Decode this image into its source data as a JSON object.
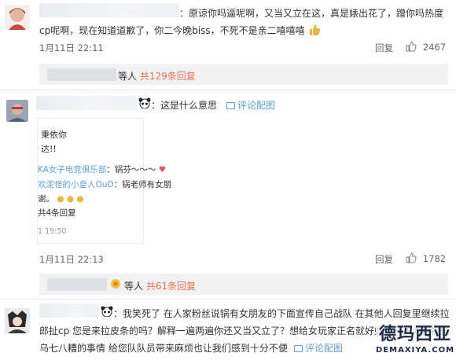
{
  "c1": {
    "line1": "：原谅你吗逼呢啊，又当又立在这，真是婊出花了，蹭你吗热度",
    "line2": "cp呢啊，现在知道道歉了，你二今晚biss，不死不是亲二嘻嘻嘻",
    "time": "1月11日 22:11",
    "reply": "回复",
    "like_count": "2467",
    "sub_people": "等人",
    "sub_count": "共129条回复"
  },
  "c2": {
    "text": "：这是什么意思",
    "img_comment": "评论配图",
    "thumb": {
      "l1": "秉依你",
      "l2": "达!!",
      "l3a": "KA女子电竞俱乐部",
      "l3b": "：锅芬～～～",
      "l4a": "欢泥怪的小皇人OuO",
      "l4b": "：锅老师有女朋",
      "l5": "谢。",
      "l6": "共4条回复",
      "l7": "1 19:50"
    },
    "time": "1月11日 22:13",
    "reply": "回复",
    "like_count": "1782",
    "sub_people": "等人",
    "sub_count": "共61条回复"
  },
  "c3": {
    "line1": "：我笑死了 在人家粉丝说锅有女朋友的下面宣传自己战队 在其他人回复里继续拉",
    "line2": "郎扯cp 您是来拉皮条的吗？解释一遍两遍你还又当又立了？想给女玩家正名就好好提升实力别搞些",
    "line3": "乌七八糟的事情 给您队队员带来麻烦也让我们感到十分不便",
    "img_comment": "评论配图"
  },
  "watermark": {
    "main": "德玛西亚",
    "sub": "DEMAXIYA.COM"
  },
  "colors": {
    "link": "#eb7350",
    "blue": "#5aa0d8",
    "sub_bg": "#f2f2f5"
  }
}
